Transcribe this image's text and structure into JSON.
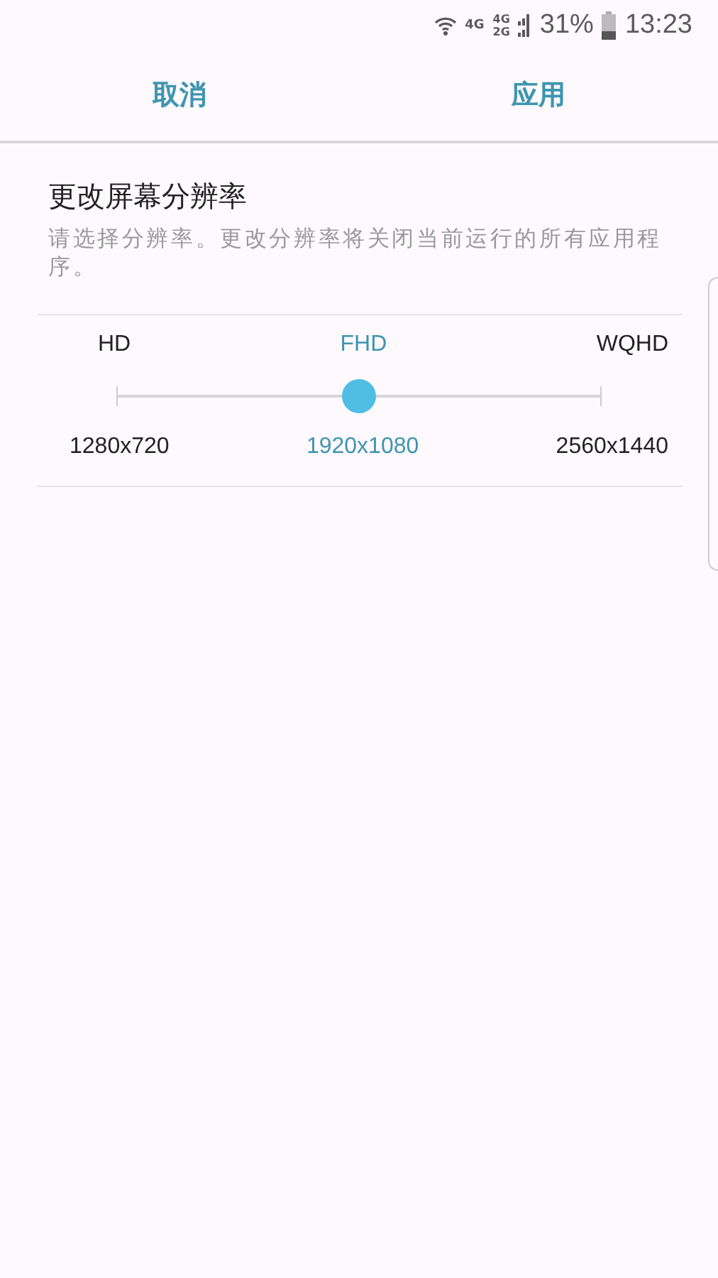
{
  "status_bar": {
    "network_1": "4G",
    "network_2_top": "4G",
    "network_2_bottom": "2G",
    "battery": "31%",
    "time": "13:23"
  },
  "action_bar": {
    "cancel": "取消",
    "apply": "应用"
  },
  "title": "更改屏幕分辨率",
  "description": "请选择分辨率。更改分辨率将关闭当前运行的所有应用程序。",
  "options": [
    {
      "label": "HD",
      "resolution": "1280x720",
      "selected": false
    },
    {
      "label": "FHD",
      "resolution": "1920x1080",
      "selected": true
    },
    {
      "label": "WQHD",
      "resolution": "2560x1440",
      "selected": false
    }
  ],
  "slider": {
    "level": 0.5
  }
}
